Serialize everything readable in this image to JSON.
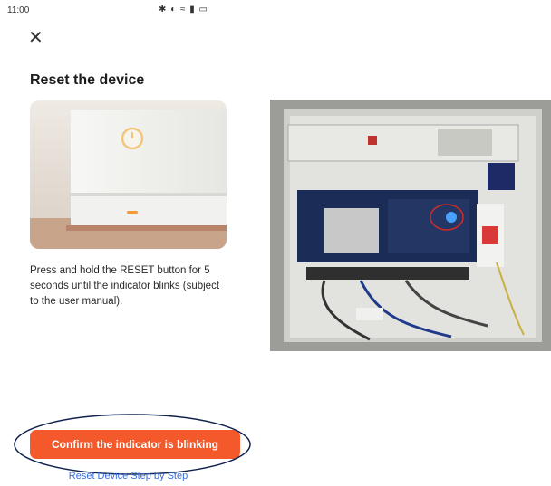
{
  "status": {
    "time": "11:00",
    "notification_icon": "notification-icon",
    "right_icons": "✱ ◐ ≈ ▮ ▭"
  },
  "header": {
    "close_icon": "close-icon",
    "close_glyph": "✕"
  },
  "main": {
    "title": "Reset the device",
    "description": "Press and hold the RESET button for 5 seconds until the indicator blinks (subject to the user manual).",
    "confirm_label": "Confirm the indicator is blinking",
    "step_link": "Reset Device Step by Step"
  },
  "colors": {
    "accent": "#f3592b",
    "link": "#3a6ed8"
  }
}
